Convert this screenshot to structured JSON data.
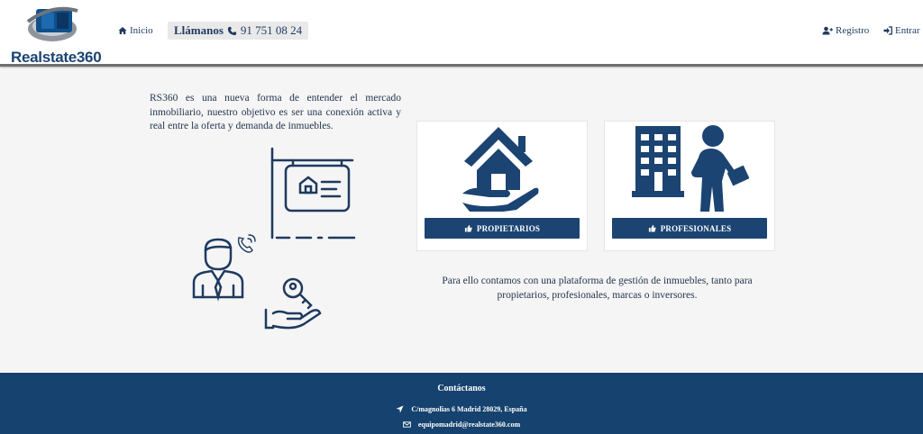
{
  "header": {
    "logo_text_a": "Realstate",
    "logo_text_b": "360",
    "nav_home": "Inicio",
    "phone_label": "Llámanos",
    "phone_number": "91 751 08 24",
    "register": "Registro",
    "login": "Entrar"
  },
  "main": {
    "intro": "RS360 es una nueva forma de entender el mercado inmobiliario, nuestro objetivo es ser una conexión activa y real entre la oferta y demanda de inmuebles.",
    "card_owners_label": "PROPIETARIOS",
    "card_pros_label": "PROFESIONALES",
    "paragraph_line1": "Para ello contamos con una plataforma de gestión de inmuebles, tanto para",
    "paragraph_line2": "propietarios, profesionales, marcas o inversores."
  },
  "footer": {
    "title": "Contáctanos",
    "address": "C/magnolias 6 Madrid 28029, España",
    "email": "equipomadrid@realstate360.com"
  },
  "colors": {
    "brand": "#1b4472",
    "footer": "#15426e",
    "background": "#f5f5f5"
  },
  "icons": [
    "home-icon",
    "phone-icon",
    "user-plus-icon",
    "sign-in-icon",
    "thumbs-up-icon",
    "location-arrow-icon",
    "envelope-icon"
  ]
}
